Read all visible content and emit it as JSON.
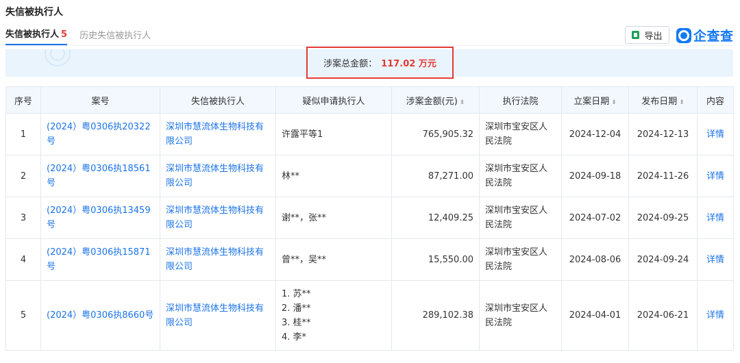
{
  "section_title": "失信被执行人",
  "tabs": [
    {
      "label": "失信被执行人",
      "count": "5"
    },
    {
      "label": "历史失信被执行人"
    }
  ],
  "export_label": "导出",
  "brand": {
    "name": "企查查",
    "color": "#1479f5"
  },
  "summary": {
    "label": "涉案总金额：",
    "value": "117.02 万元",
    "highlight_color": "#e53935"
  },
  "table": {
    "headers": [
      "序号",
      "案号",
      "失信被执行人",
      "疑似申请执行人",
      "涉案金额(元)",
      "执行法院",
      "立案日期",
      "发布日期",
      "内容"
    ],
    "sortable": [
      false,
      false,
      false,
      false,
      true,
      false,
      true,
      true,
      false
    ],
    "rows": [
      {
        "no": "1",
        "case_no": "(2024）粤0306执20322号",
        "debtor": "深圳市慧流体生物科技有限公司",
        "applicants": [
          "许露平等1"
        ],
        "amount": "765,905.32",
        "court": "深圳市宝安区人民法院",
        "filed": "2024-12-04",
        "published": "2024-12-13",
        "detail": "详情"
      },
      {
        "no": "2",
        "case_no": "(2024）粤0306执18561号",
        "debtor": "深圳市慧流体生物科技有限公司",
        "applicants": [
          "林**"
        ],
        "amount": "87,271.00",
        "court": "深圳市宝安区人民法院",
        "filed": "2024-09-18",
        "published": "2024-11-26",
        "detail": "详情"
      },
      {
        "no": "3",
        "case_no": "(2024）粤0306执13459号",
        "debtor": "深圳市慧流体生物科技有限公司",
        "applicants": [
          "谢**，张**"
        ],
        "amount": "12,409.25",
        "court": "深圳市宝安区人民法院",
        "filed": "2024-07-02",
        "published": "2024-09-25",
        "detail": "详情"
      },
      {
        "no": "4",
        "case_no": "(2024）粤0306执15871号",
        "debtor": "深圳市慧流体生物科技有限公司",
        "applicants": [
          "曾**，吴**"
        ],
        "amount": "15,550.00",
        "court": "深圳市宝安区人民法院",
        "filed": "2024-08-06",
        "published": "2024-09-24",
        "detail": "详情"
      },
      {
        "no": "5",
        "case_no": "(2024）粤0306执8660号",
        "debtor": "深圳市慧流体生物科技有限公司",
        "applicants": [
          "1. 苏**",
          "2. 潘**",
          "3. 桂**",
          "4. 李*"
        ],
        "amount": "289,102.38",
        "court": "深圳市宝安区人民法院",
        "filed": "2024-04-01",
        "published": "2024-06-21",
        "detail": "详情"
      }
    ]
  }
}
